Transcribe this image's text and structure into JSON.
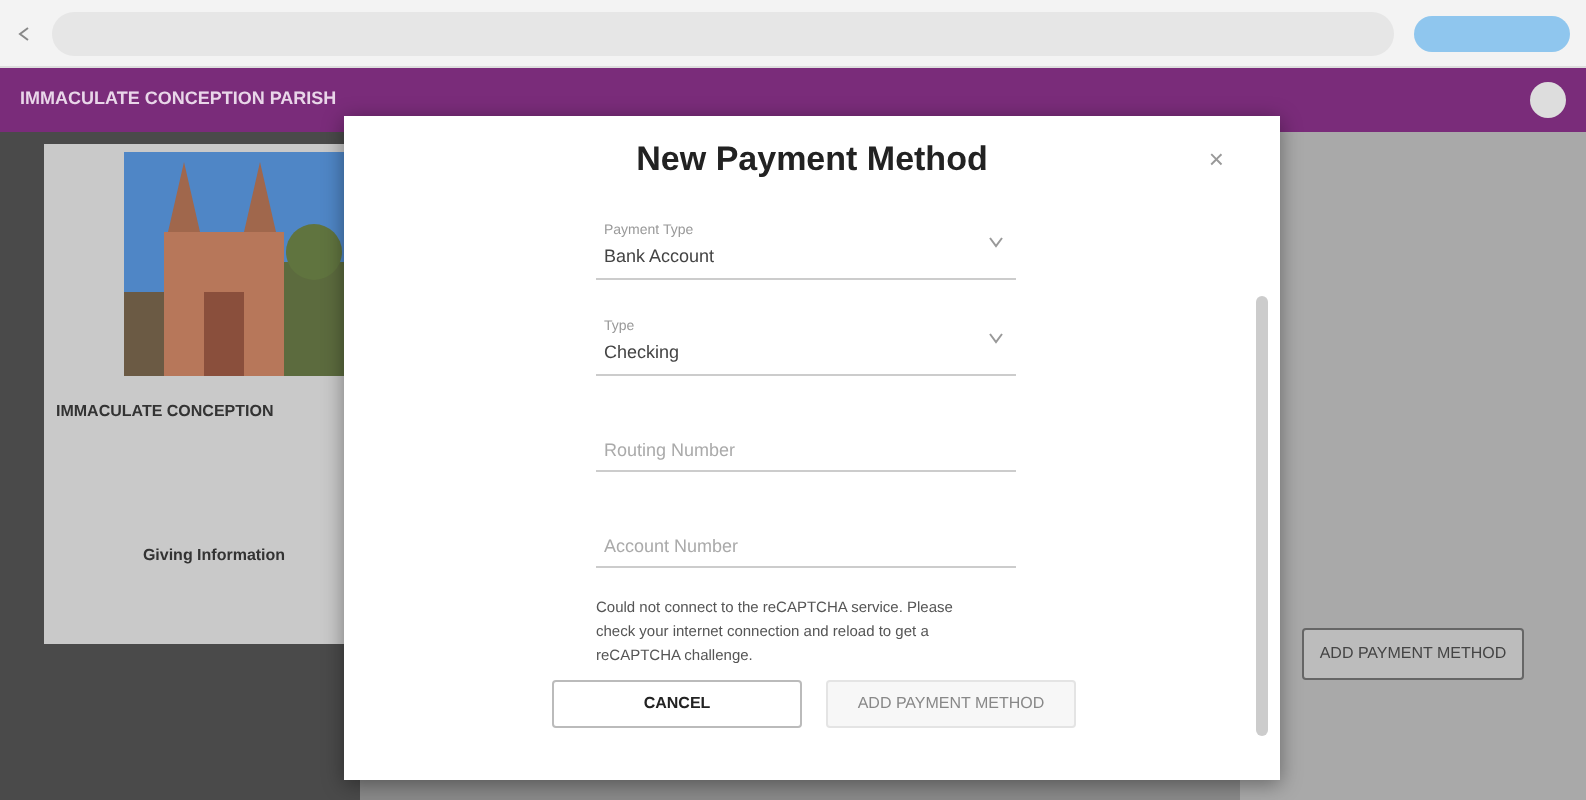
{
  "app_bar": {
    "title": "IMMACULATE CONCEPTION PARISH"
  },
  "parish_card": {
    "name": "IMMACULATE CONCEPTION",
    "giving_heading": "Giving Information"
  },
  "background_button": "ADD PAYMENT METHOD",
  "modal": {
    "title": "New Payment Method",
    "close": "×",
    "fields": [
      {
        "kind": "select",
        "label": "Payment Type",
        "value": "Bank Account"
      },
      {
        "kind": "select",
        "label": "Type",
        "value": "Checking"
      },
      {
        "kind": "input",
        "placeholder": "Routing Number"
      },
      {
        "kind": "input",
        "placeholder": "Account Number"
      }
    ],
    "captcha_message": "Could not connect to the reCAPTCHA service. Please check your internet connection and reload to get a reCAPTCHA challenge.",
    "buttons": [
      {
        "label": "CANCEL",
        "disabled": false
      },
      {
        "label": "ADD PAYMENT METHOD",
        "disabled": true
      }
    ]
  }
}
